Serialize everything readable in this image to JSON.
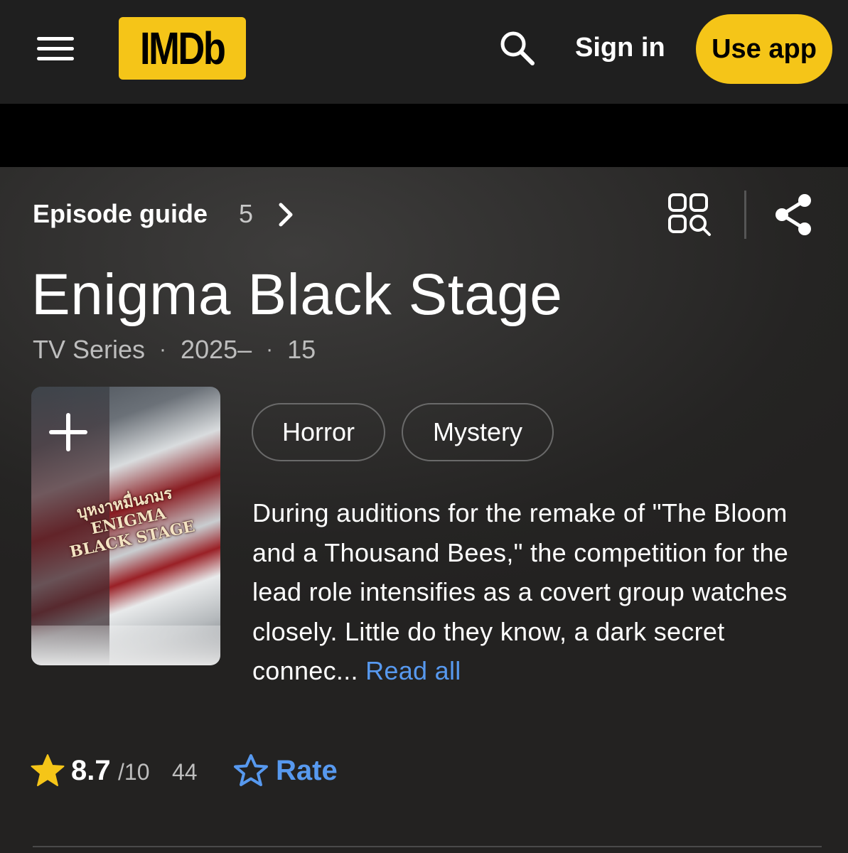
{
  "nav": {
    "logo_text": "IMDb",
    "signin_label": "Sign in",
    "useapp_label": "Use app",
    "menu_icon": "hamburger-menu-icon",
    "search_icon": "search-icon"
  },
  "header": {
    "episode_guide_label": "Episode guide",
    "episode_count": "5",
    "grid_icon": "grid-search-icon",
    "share_icon": "share-icon"
  },
  "title": {
    "name": "Enigma Black Stage",
    "type": "TV Series",
    "years": "2025–",
    "certificate": "15"
  },
  "poster": {
    "title_art": "บุหงาหมื่นภมร ENIGMA BLACK STAGE"
  },
  "genres": [
    "Horror",
    "Mystery"
  ],
  "plot": {
    "text": "During auditions for the remake of \"The Bloom and a Thousand Bees,\" the competition for the lead role intensifies as a covert group watches closely. Little do they know, a dark secret connec...",
    "read_all_label": "Read all"
  },
  "rating": {
    "value": "8.7",
    "max": "/10",
    "count": "44",
    "rate_label": "Rate"
  },
  "colors": {
    "imdb_yellow": "#f5c518",
    "link_blue": "#5799ef",
    "background": "#1f1f1f"
  }
}
